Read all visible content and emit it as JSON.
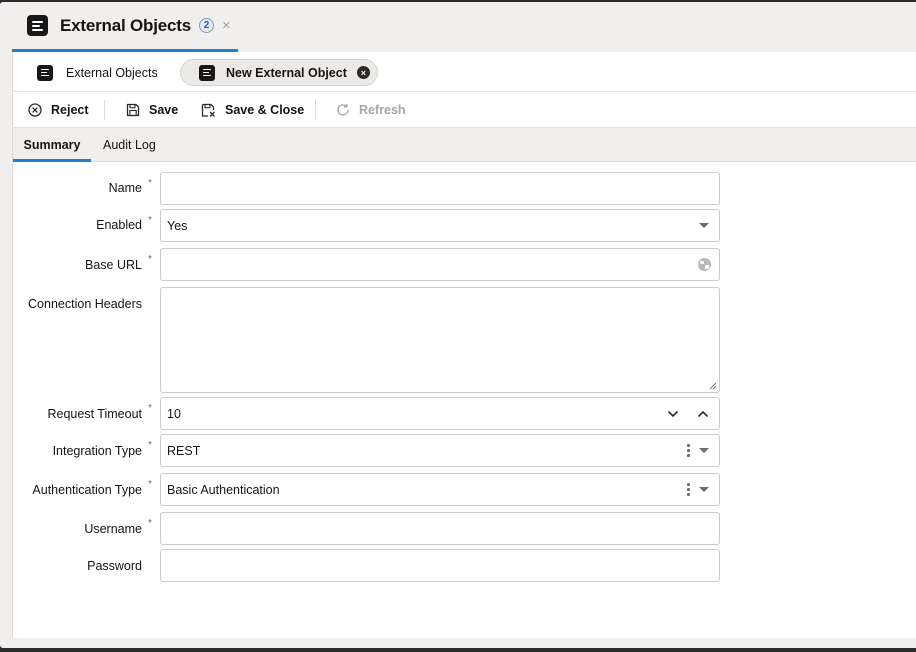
{
  "header": {
    "title": "External Objects",
    "badge_count": "2",
    "close_symbol": "×"
  },
  "subtabs": [
    {
      "label": "External Objects",
      "icon": "document-list-icon"
    },
    {
      "label": "New External Object",
      "icon": "document-list-icon",
      "close_symbol": "×"
    }
  ],
  "toolbar": {
    "reject_label": "Reject",
    "save_label": "Save",
    "save_close_label": "Save & Close",
    "refresh_label": "Refresh"
  },
  "page_tabs": [
    "Summary",
    "Audit Log"
  ],
  "form": {
    "name": {
      "label": "Name",
      "required": "*",
      "value": ""
    },
    "enabled": {
      "label": "Enabled",
      "required": "*",
      "value": "Yes"
    },
    "base_url": {
      "label": "Base URL",
      "required": "*",
      "value": ""
    },
    "connection_headers": {
      "label": "Connection Headers",
      "value": ""
    },
    "request_timeout": {
      "label": "Request Timeout",
      "required": "*",
      "value": "10"
    },
    "integration_type": {
      "label": "Integration Type",
      "required": "*",
      "value": "REST"
    },
    "authentication_type": {
      "label": "Authentication Type",
      "required": "*",
      "value": "Basic Authentication"
    },
    "username": {
      "label": "Username",
      "required": "*",
      "value": ""
    },
    "password": {
      "label": "Password",
      "value": ""
    }
  },
  "colors": {
    "accent": "#227ecf",
    "background": "#f1efed"
  }
}
